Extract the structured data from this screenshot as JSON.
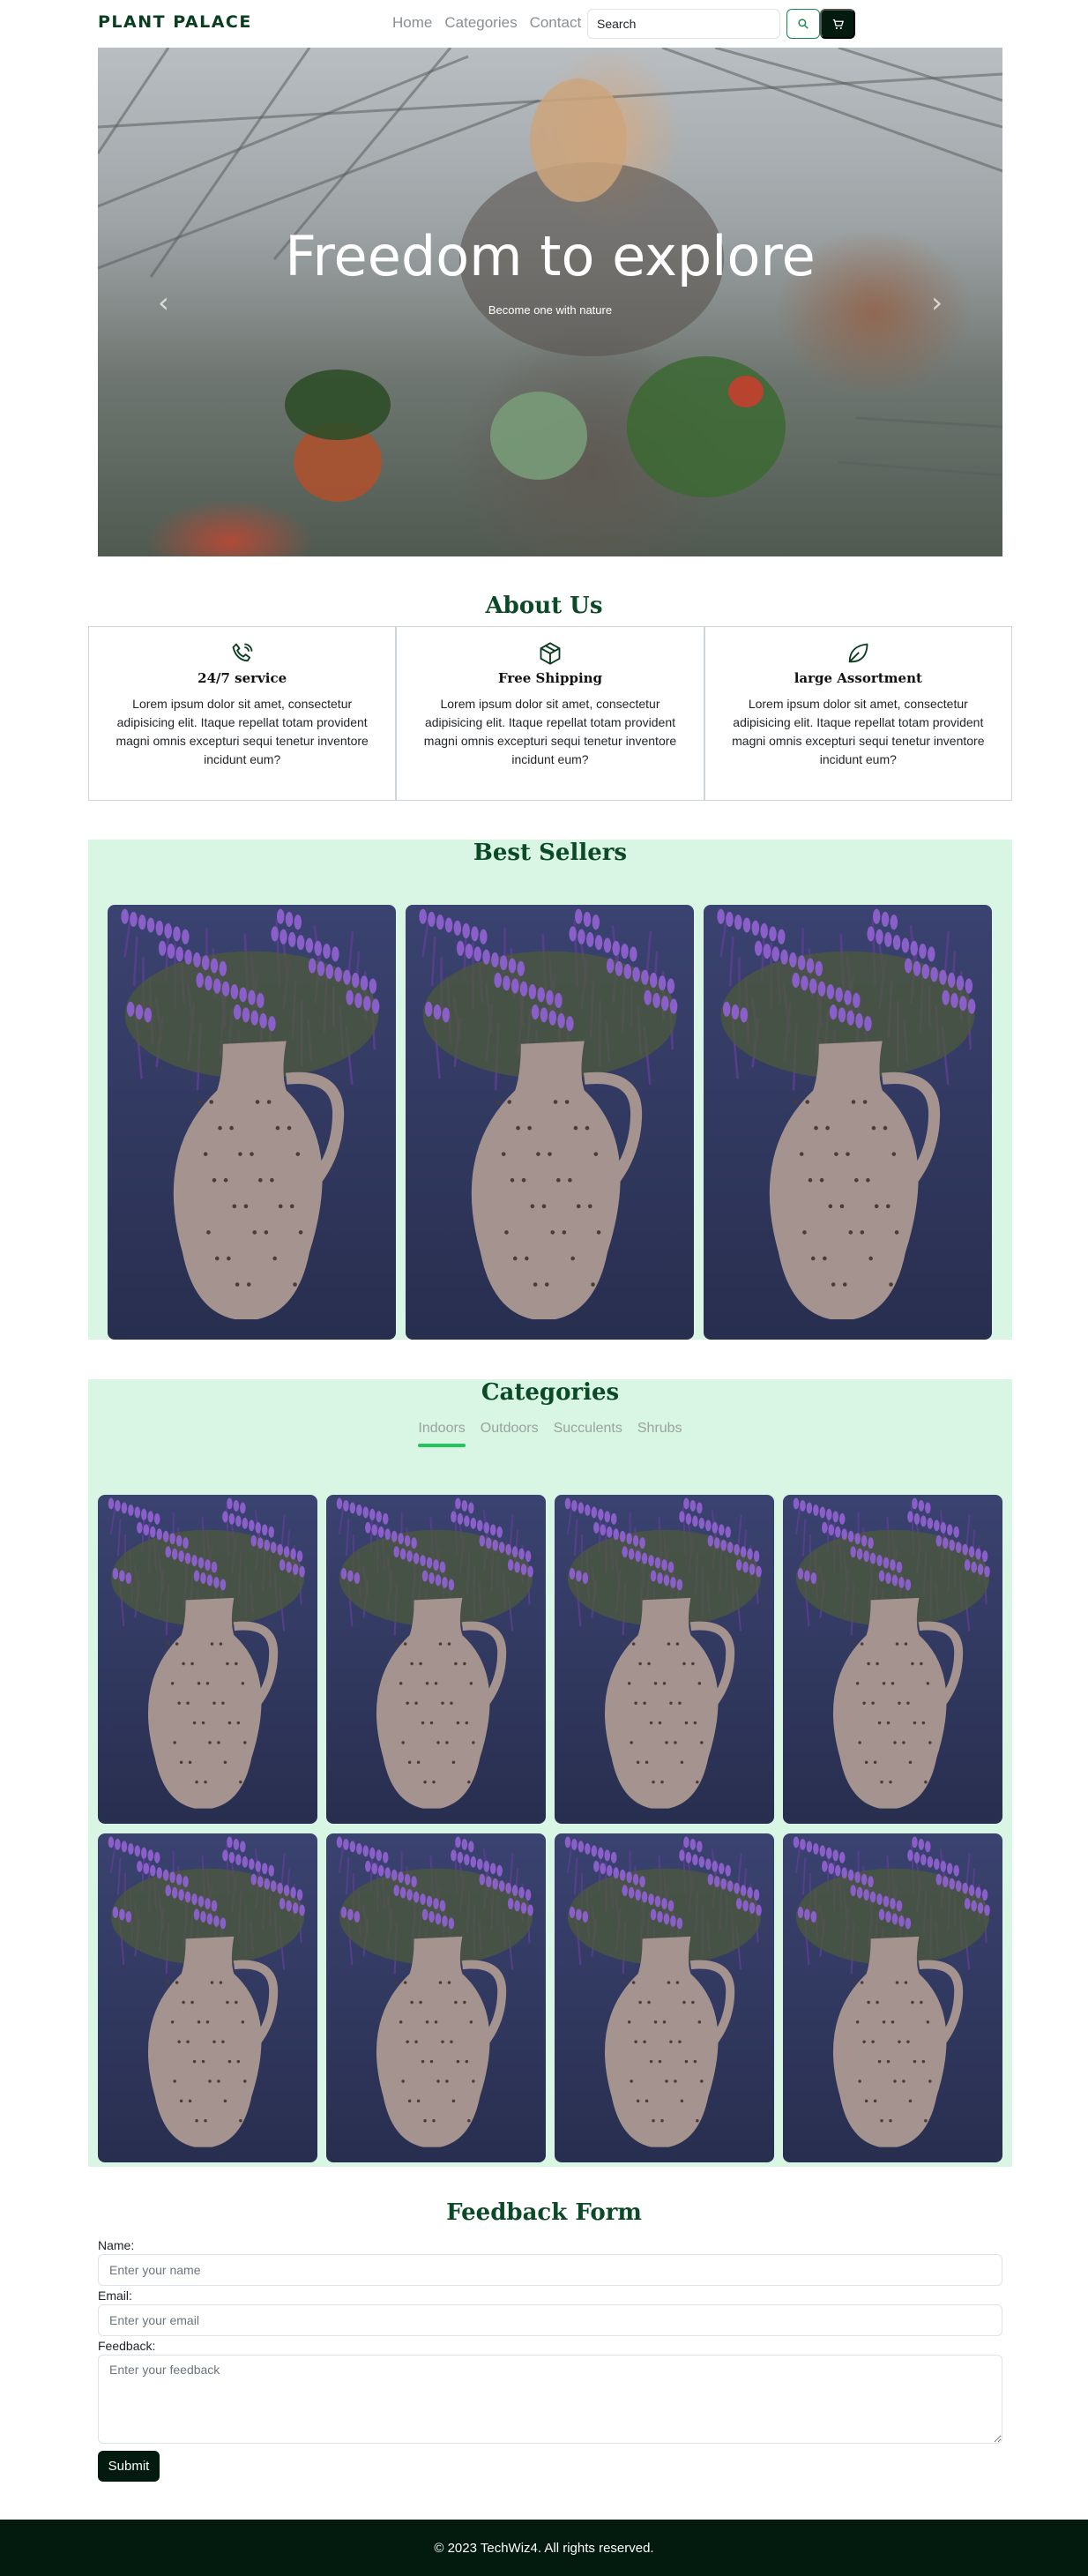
{
  "navbar": {
    "brand": "PLANT PALACE",
    "links": [
      "Home",
      "Categories",
      "Contact"
    ],
    "search_placeholder": "Search",
    "search_icon": "search-icon",
    "cart_icon": "cart-icon"
  },
  "hero": {
    "title": "Freedom to explore",
    "subtitle": "Become one with nature",
    "prev_icon": "chevron-left-icon",
    "next_icon": "chevron-right-icon"
  },
  "about": {
    "heading": "About Us",
    "cards": [
      {
        "icon": "phone-icon",
        "title": "24/7 service",
        "text": "Lorem ipsum dolor sit amet, consectetur adipisicing elit. Itaque repellat totam provident magni omnis excepturi sequi tenetur inventore incidunt eum?"
      },
      {
        "icon": "box-icon",
        "title": "Free Shipping",
        "text": "Lorem ipsum dolor sit amet, consectetur adipisicing elit. Itaque repellat totam provident magni omnis excepturi sequi tenetur inventore incidunt eum?"
      },
      {
        "icon": "leaf-icon",
        "title": "large Assortment",
        "text": "Lorem ipsum dolor sit amet, consectetur adipisicing elit. Itaque repellat totam provident magni omnis excepturi sequi tenetur inventore incidunt eum?"
      }
    ]
  },
  "best_sellers": {
    "heading": "Best Sellers"
  },
  "categories": {
    "heading": "Categories",
    "tabs": [
      "Indoors",
      "Outdoors",
      "Succulents",
      "Shrubs"
    ],
    "active_tab": "Indoors"
  },
  "feedback": {
    "heading": "Feedback Form",
    "name_label": "Name:",
    "name_placeholder": "Enter your name",
    "email_label": "Email:",
    "email_placeholder": "Enter your email",
    "feedback_label": "Feedback:",
    "feedback_placeholder": "Enter your feedback",
    "submit_label": "Submit"
  },
  "footer": {
    "text": "© 2023 TechWiz4. All rights reserved."
  },
  "colors": {
    "brand_green": "#0b4a26",
    "dark_button": "#031a0e",
    "section_bg": "#d9f5e4",
    "tab_underline": "#22c55e"
  }
}
